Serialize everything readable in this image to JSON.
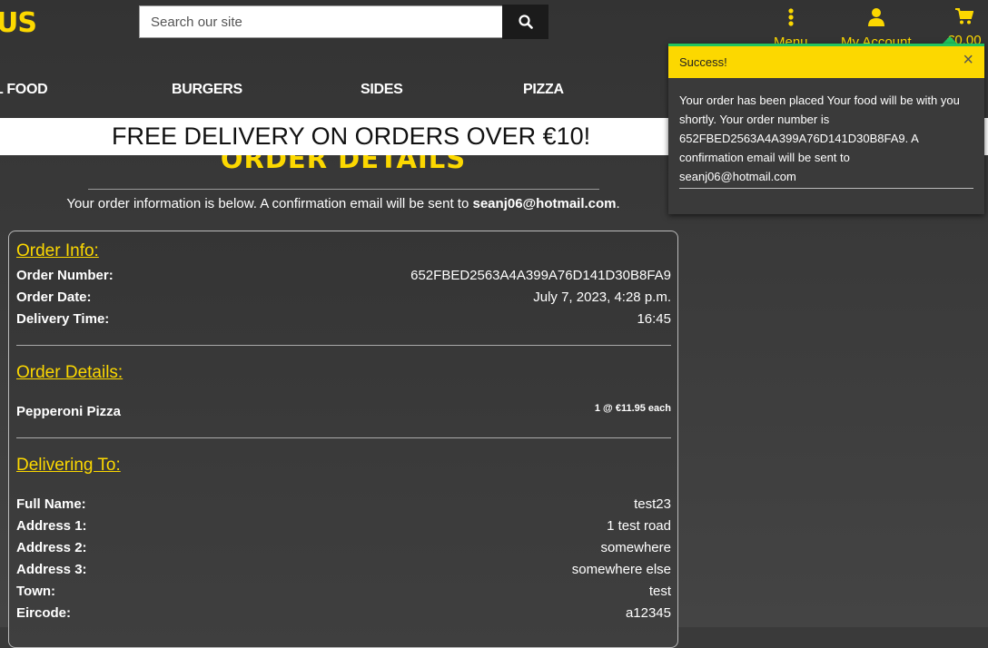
{
  "header": {
    "logo_text": "US",
    "search_placeholder": "Search our site",
    "menu_label": "Menu",
    "account_label": "My Account",
    "cart_label": "€0.00"
  },
  "categories": [
    "L FOOD",
    "BURGERS",
    "SIDES",
    "PIZZA"
  ],
  "banner": "FREE DELIVERY ON ORDERS OVER €10!",
  "page_title": "ORDER DETAILS",
  "intro": {
    "text": "Your order information is below. A confirmation email will be sent to ",
    "email": "seanj06@hotmail.com",
    "end": "."
  },
  "order_info": {
    "title": "Order Info:",
    "rows": [
      {
        "label": "Order Number:",
        "value": "652FBED2563A4A399A76D141D30B8FA9"
      },
      {
        "label": "Order Date:",
        "value": "July 7, 2023, 4:28 p.m."
      },
      {
        "label": "Delivery Time:",
        "value": "16:45"
      }
    ]
  },
  "order_details": {
    "title": "Order Details:",
    "items": [
      {
        "name": "Pepperoni Pizza",
        "qty_price": "1 @ €11.95 each"
      }
    ]
  },
  "delivering_to": {
    "title": "Delivering To:",
    "rows": [
      {
        "label": "Full Name:",
        "value": "test23"
      },
      {
        "label": "Address 1:",
        "value": "1 test road"
      },
      {
        "label": "Address 2:",
        "value": "somewhere"
      },
      {
        "label": "Address 3:",
        "value": "somewhere else"
      },
      {
        "label": "Town:",
        "value": "test"
      },
      {
        "label": "Eircode:",
        "value": "a12345"
      }
    ]
  },
  "toast": {
    "title": "Success!",
    "close": "×",
    "message": "Your order has been placed Your food will be with you shortly. Your order number is 652FBED2563A4A399A76D141D30B8FA9. A confirmation email will be sent to seanj06@hotmail.com"
  },
  "colors": {
    "accent": "#fcd800",
    "success": "#22c55e",
    "background": "#3a3a3a"
  }
}
